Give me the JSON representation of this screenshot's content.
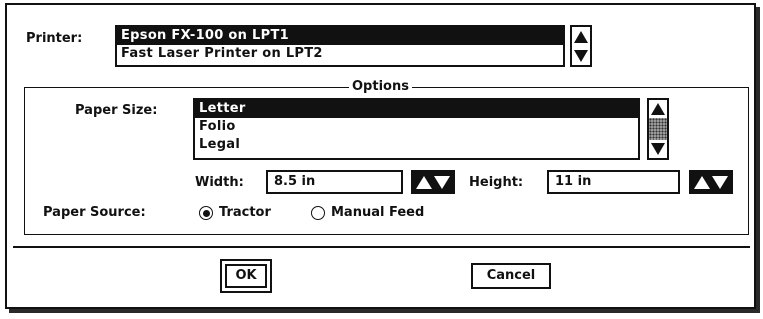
{
  "printer": {
    "label": "Printer:",
    "options": [
      "Epson FX-100 on LPT1",
      "Fast Laser Printer on LPT2"
    ],
    "selected": "Epson FX-100 on LPT1"
  },
  "options_group": {
    "title": "Options"
  },
  "paper_size": {
    "label": "Paper Size:",
    "options": [
      "Letter",
      "Folio",
      "Legal"
    ],
    "selected": "Letter"
  },
  "width": {
    "label": "Width:",
    "value": "8.5 in"
  },
  "height": {
    "label": "Height:",
    "value": "11 in"
  },
  "paper_source": {
    "label": "Paper Source:",
    "options": [
      "Tractor",
      "Manual Feed"
    ],
    "selected": "Tractor"
  },
  "buttons": {
    "ok": "OK",
    "cancel": "Cancel"
  }
}
